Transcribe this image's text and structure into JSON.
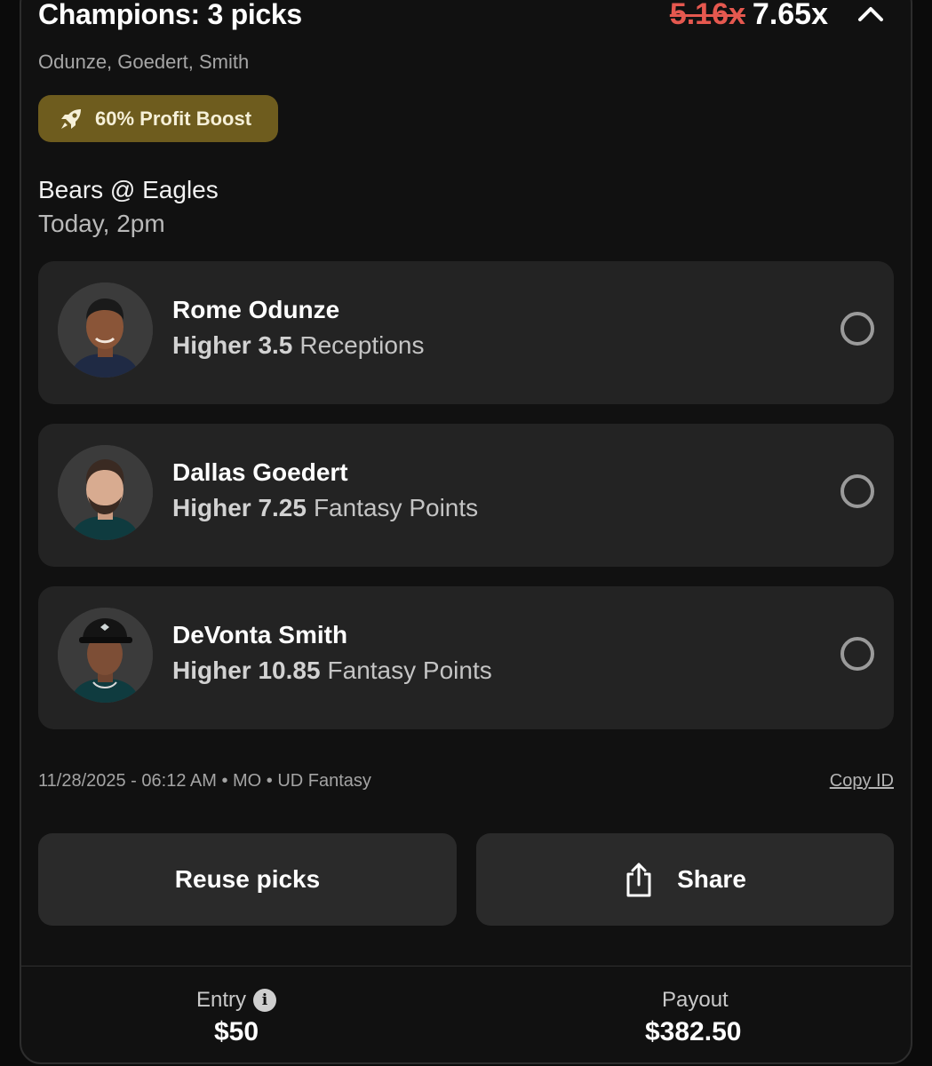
{
  "header": {
    "title": "Champions: 3 picks",
    "old_multiplier": "5.16x",
    "new_multiplier": "7.65x",
    "collapse_icon": "chevron-up-icon",
    "players_summary": "Odunze, Goedert, Smith"
  },
  "boost": {
    "icon": "rocket-icon",
    "label": "60% Profit Boost",
    "color": "#6e5c1e"
  },
  "game": {
    "matchup": "Bears @ Eagles",
    "time": "Today, 2pm"
  },
  "picks": [
    {
      "name": "Rome Odunze",
      "direction": "Higher 3.5",
      "stat": "Receptions",
      "jersey_color": "#1f2a44"
    },
    {
      "name": "Dallas Goedert",
      "direction": "Higher 7.25",
      "stat": "Fantasy Points",
      "jersey_color": "#0f3b3f"
    },
    {
      "name": "DeVonta Smith",
      "direction": "Higher 10.85",
      "stat": "Fantasy Points",
      "jersey_color": "#0f3b3f"
    }
  ],
  "meta": {
    "info": "11/28/2025 - 06:12 AM • MO • UD Fantasy",
    "copy_id": "Copy ID"
  },
  "actions": {
    "reuse": "Reuse picks",
    "share": "Share",
    "share_icon": "share-icon"
  },
  "footer": {
    "entry_label": "Entry",
    "entry_value": "$50",
    "info_icon": "info-icon",
    "payout_label": "Payout",
    "payout_value": "$382.50"
  },
  "colors": {
    "accent_strike": "#e5584f",
    "card_bg": "#232323",
    "page_bg": "#111111"
  }
}
